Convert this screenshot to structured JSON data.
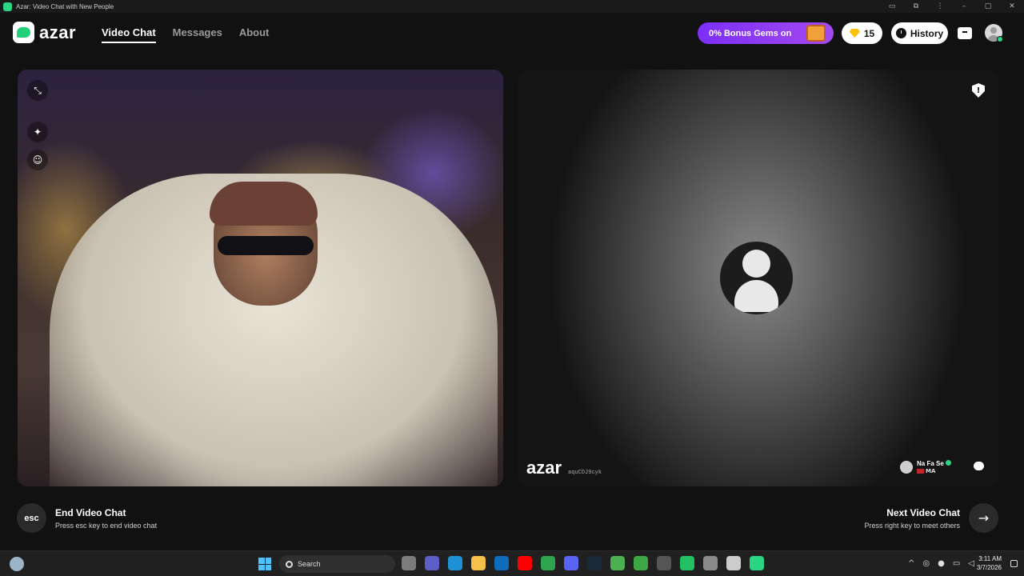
{
  "window": {
    "title": "Azar: Video Chat with New People"
  },
  "nav": {
    "logo": "azar",
    "links": [
      "Video Chat",
      "Messages",
      "About"
    ],
    "active": "Video Chat"
  },
  "header": {
    "bonus_text": "0% Bonus Gems on",
    "gems_count": "15",
    "history_label": "History"
  },
  "partner": {
    "watermark": "azar",
    "watermark_id": "aquCDJ9cyk",
    "name": "Na Fa Se",
    "country": "MA"
  },
  "actions": {
    "end_key": "esc",
    "end_title": "End Video Chat",
    "end_sub": "Press esc key to end video chat",
    "next_title": "Next Video Chat",
    "next_sub": "Press right key to meet others"
  },
  "taskbar": {
    "search_placeholder": "Search",
    "time": "3:11 AM",
    "date": "3/7/2026",
    "app_colors": [
      "#7c7c7c",
      "#5b5fc7",
      "#1f8fd6",
      "#f5c04a",
      "#0f6cbd",
      "#ff0000",
      "#2fa54f",
      "#5865f2",
      "#1b2838",
      "#4caf50",
      "#3ea745",
      "#555555",
      "#21c063",
      "#8a8a8a",
      "#cccccc",
      "#2ad584"
    ]
  },
  "colors": {
    "accent": "#2ad584",
    "bonus_start": "#7b2ff7",
    "bonus_end": "#a349f0"
  }
}
